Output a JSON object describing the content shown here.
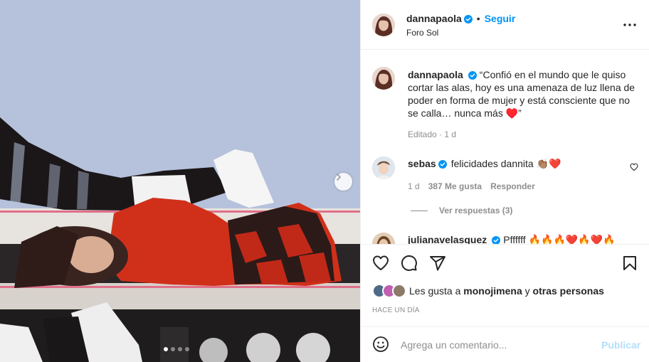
{
  "post": {
    "username": "dannapaola",
    "separator": "•",
    "follow_label": "Seguir",
    "location": "Foro Sol",
    "more_icon": "more-horizontal-icon"
  },
  "caption": {
    "username": "dannapaola",
    "text": "“Confió en el mundo que le quiso cortar las alas, hoy es una amenaza de luz llena de poder en forma de mujer y está consciente que no se calla… nunca más ♥️”",
    "meta": "Editado · 1 d"
  },
  "comment": {
    "username": "sebas",
    "text": "felicidades dannita 👏🏽❤️",
    "age": "1 d",
    "likes": "387 Me gusta",
    "reply_label": "Responder",
    "view_replies": "Ver respuestas (3)"
  },
  "comment2": {
    "username": "julianavelasquez",
    "text": "Pffffff 🔥🔥🔥❤️🔥❤️🔥"
  },
  "likes": {
    "prefix": "Les gusta a",
    "user": "monojimena",
    "connector": "y",
    "others": "otras personas"
  },
  "time_ago": "HACE UN DÍA",
  "add_comment": {
    "placeholder": "Agrega un comentario...",
    "publish_label": "Publicar"
  },
  "carousel": {
    "slides": 4,
    "active": 0
  },
  "colors": {
    "accent": "#0095f6",
    "publish_disabled": "#b2dffc",
    "secondary_text": "#8e8e8e",
    "photo_background": "#b6c2dc",
    "outfit_red": "#d0301a"
  }
}
